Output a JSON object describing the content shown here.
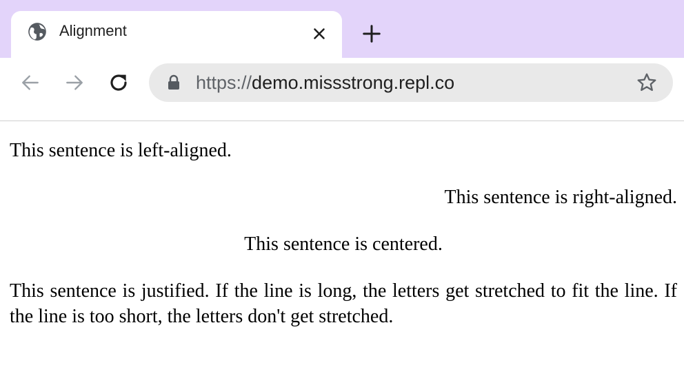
{
  "browser": {
    "tab": {
      "title": "Alignment",
      "icon": "globe-icon"
    },
    "new_tab_icon": "plus-icon",
    "toolbar": {
      "back_icon": "arrow-left-icon",
      "forward_icon": "arrow-right-icon",
      "reload_icon": "reload-icon",
      "address": {
        "scheme": "https://",
        "host": "demo.missstrong.repl.co",
        "lock_icon": "lock-icon",
        "bookmark_icon": "star-icon"
      }
    },
    "colors": {
      "tabbar_background": "#e3d4fa",
      "omnibox_background": "#e9e9e9"
    }
  },
  "page": {
    "left_text": "This sentence is left-aligned.",
    "right_text": "This sentence is right-aligned.",
    "center_text": "This sentence is centered.",
    "justified_text": "This sentence is justified. If the line is long, the letters get stretched to fit the line. If the line is too short, the letters don't get stretched."
  }
}
